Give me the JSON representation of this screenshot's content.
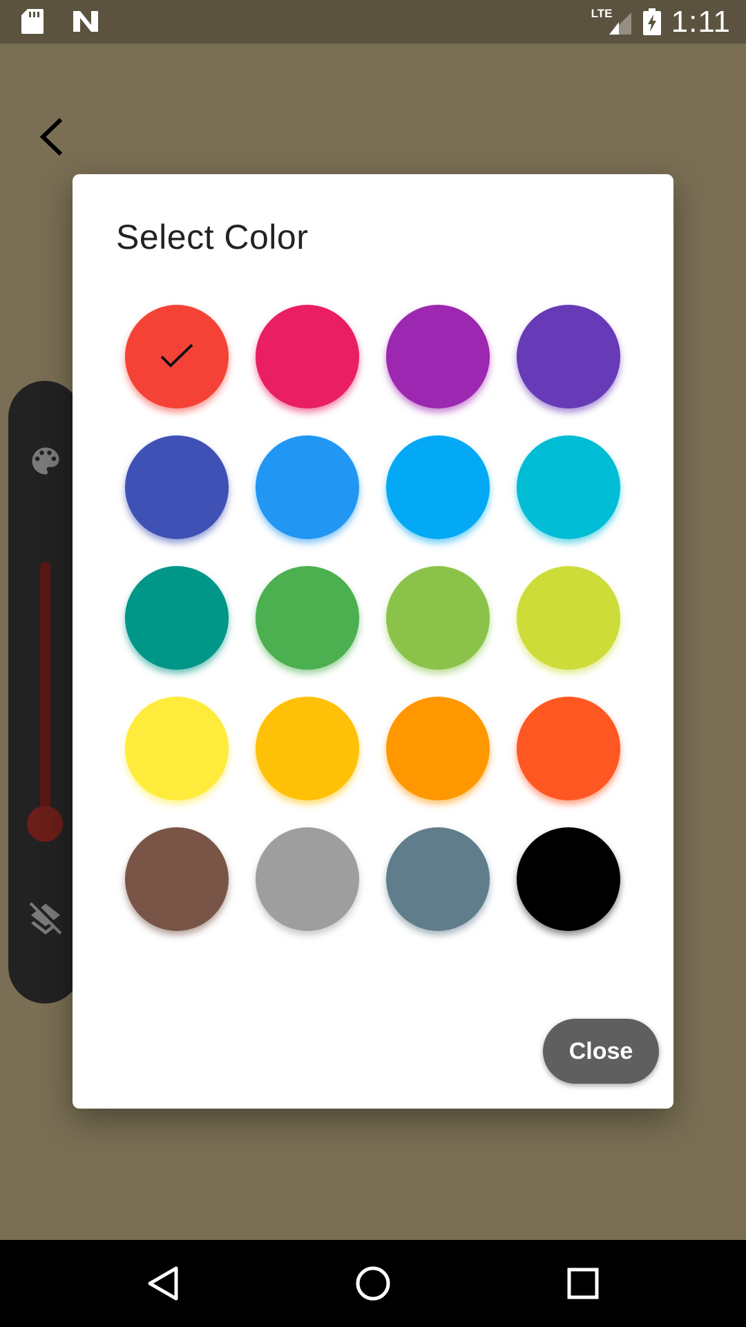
{
  "status_bar": {
    "time": "1:11",
    "network": "LTE",
    "icons": [
      "sd-card-icon",
      "n-logo-icon",
      "signal-icon",
      "battery-charging-icon"
    ]
  },
  "toolbar": {
    "back_icon": "chevron-left-icon",
    "palette_icon": "palette-icon",
    "layers_off_icon": "layers-off-icon",
    "slider_color": "#5b1714",
    "slider_level": 1.0
  },
  "dialog": {
    "title": "Select Color",
    "close_label": "Close",
    "selected_index": 0,
    "swatches": [
      {
        "color": "#f44336"
      },
      {
        "color": "#e91e63"
      },
      {
        "color": "#9c27b0"
      },
      {
        "color": "#673ab7"
      },
      {
        "color": "#3f51b5"
      },
      {
        "color": "#2196f3"
      },
      {
        "color": "#03a9f4"
      },
      {
        "color": "#00bcd4"
      },
      {
        "color": "#009688"
      },
      {
        "color": "#4caf50"
      },
      {
        "color": "#8bc34a"
      },
      {
        "color": "#cddc39"
      },
      {
        "color": "#ffeb3b"
      },
      {
        "color": "#ffc107"
      },
      {
        "color": "#ff9800"
      },
      {
        "color": "#ff5722"
      },
      {
        "color": "#795548"
      },
      {
        "color": "#9e9e9e"
      },
      {
        "color": "#607d8b"
      },
      {
        "color": "#000000"
      }
    ]
  },
  "nav_bar": {
    "icons": [
      "back-triangle-icon",
      "home-circle-icon",
      "recents-square-icon"
    ]
  }
}
